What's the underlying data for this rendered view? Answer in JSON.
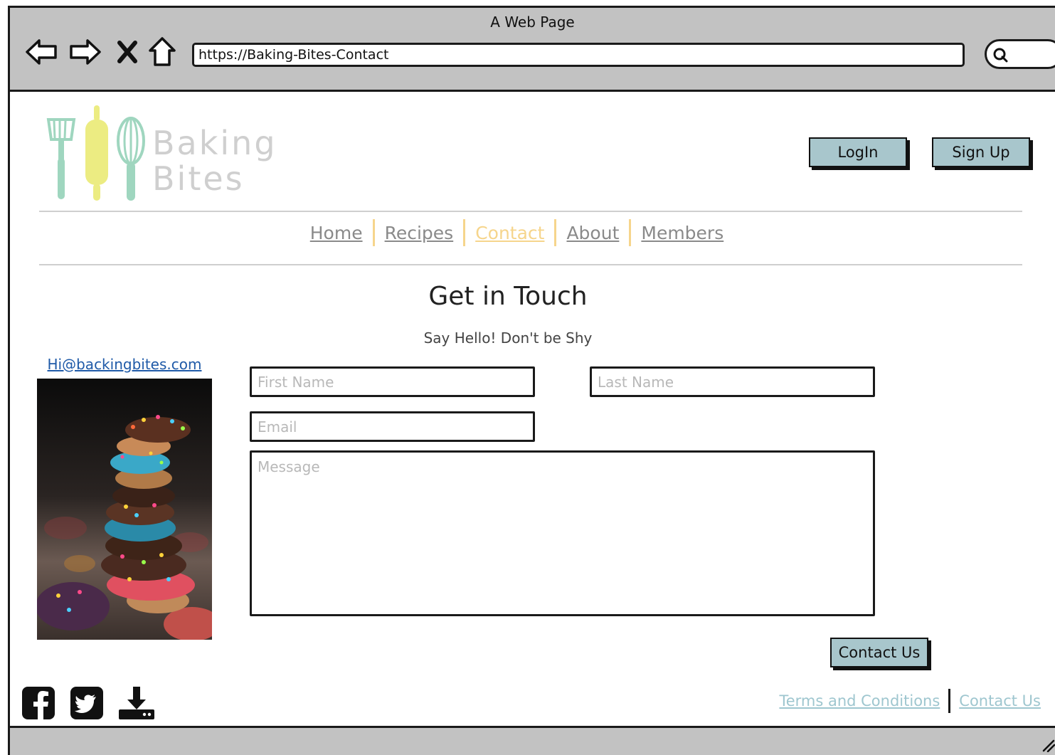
{
  "browser": {
    "window_title": "A Web Page",
    "url": "https://Baking-Bites-Contact"
  },
  "header": {
    "logo_line1": "Baking",
    "logo_line2": "Bites",
    "login_label": "LogIn",
    "signup_label": "Sign Up"
  },
  "nav": {
    "items": [
      {
        "label": "Home"
      },
      {
        "label": "Recipes"
      },
      {
        "label": "Contact"
      },
      {
        "label": "About"
      },
      {
        "label": "Members"
      }
    ],
    "active": "Contact"
  },
  "contact": {
    "title": "Get in Touch",
    "subtitle": "Say Hello! Don't be Shy",
    "email": "Hi@backingbites.com",
    "first_name_placeholder": "First Name",
    "last_name_placeholder": "Last Name",
    "email_placeholder": "Email",
    "message_placeholder": "Message",
    "submit_label": "Contact Us"
  },
  "footer": {
    "terms_label": "Terms and Conditions",
    "contact_label": "Contact Us",
    "icons": [
      "facebook-icon",
      "twitter-icon",
      "download-icon"
    ]
  },
  "colors": {
    "button_fill": "#a8c6cc",
    "nav_active": "#f6d58c",
    "nav_inactive": "#8a8a8a",
    "footer_link": "#9ec6cf",
    "chrome": "#c2c2c2",
    "logo_yellow": "#ecec82",
    "logo_mint": "#9fd6bf"
  }
}
